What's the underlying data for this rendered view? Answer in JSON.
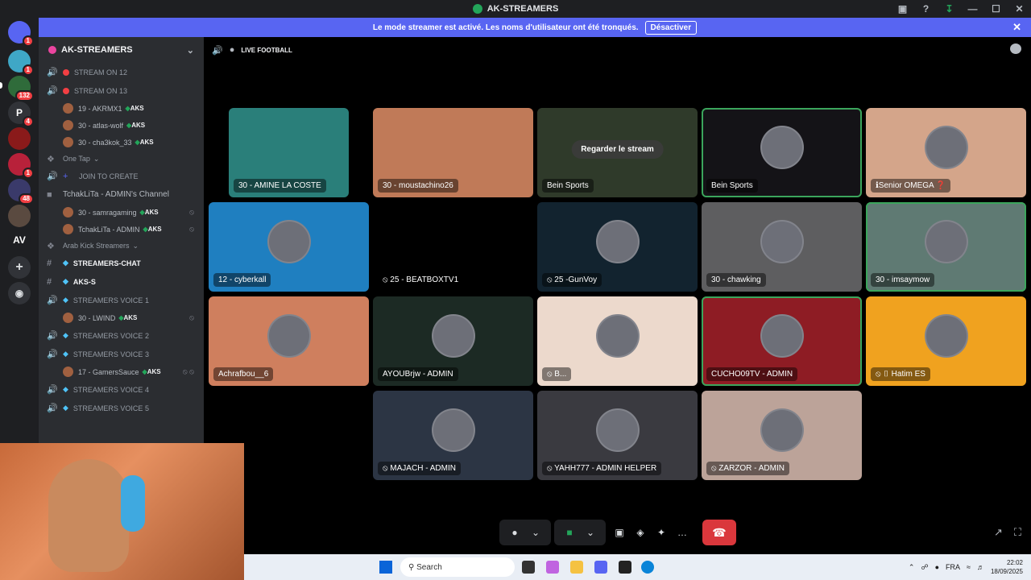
{
  "window": {
    "title": "AK-STREAMERS",
    "controls": [
      "—",
      "☐",
      "✕"
    ]
  },
  "banner": {
    "message": "Le mode streamer est activé. Les noms d'utilisateur ont été tronqués.",
    "button": "Désactiver"
  },
  "servers": [
    {
      "label": "",
      "badge": "1"
    },
    {
      "label": "",
      "badge": "1"
    },
    {
      "label": "",
      "badge": "132"
    },
    {
      "label": "P",
      "badge": "4"
    },
    {
      "label": "",
      "badge": ""
    },
    {
      "label": "",
      "badge": "1"
    },
    {
      "label": "",
      "badge": "48"
    },
    {
      "label": "",
      "badge": ""
    },
    {
      "label": "AV",
      "badge": ""
    }
  ],
  "sidebar": {
    "guild_name": "AK-STREAMERS",
    "items": [
      {
        "kind": "channel",
        "name": "STREAM ON 12",
        "icon": "dot"
      },
      {
        "kind": "channel",
        "name": "STREAM ON 13",
        "icon": "dot"
      },
      {
        "kind": "user",
        "name": "19 - AKRMX1",
        "tag": "AKS",
        "mute": ""
      },
      {
        "kind": "user",
        "name": "30 - atlas-wolf",
        "tag": "AKS",
        "mute": ""
      },
      {
        "kind": "user",
        "name": "30 - cha3kok_33",
        "tag": "AKS",
        "mute": ""
      },
      {
        "kind": "category",
        "name": "One Tap"
      },
      {
        "kind": "channel",
        "name": "JOIN TO CREATE",
        "icon": "plus"
      },
      {
        "kind": "locked",
        "name": "TchakLiTa - ADMIN's Channel"
      },
      {
        "kind": "user",
        "name": "30 - samragaming",
        "tag": "AKS",
        "mute": "⦸"
      },
      {
        "kind": "user",
        "name": "TchakLiTa - ADMIN",
        "tag": "AKS",
        "mute": "⦸"
      },
      {
        "kind": "category",
        "name": "Arab Kick Streamers"
      },
      {
        "kind": "text",
        "name": "STREAMERS-CHAT",
        "active": true
      },
      {
        "kind": "text",
        "name": "AKS-S",
        "active": true
      },
      {
        "kind": "channel",
        "name": "STREAMERS VOICE 1",
        "icon": "gem"
      },
      {
        "kind": "user",
        "name": "30 - LWIND",
        "tag": "AKS",
        "mute": "⦸"
      },
      {
        "kind": "channel",
        "name": "STREAMERS VOICE 2",
        "icon": "gem"
      },
      {
        "kind": "channel",
        "name": "STREAMERS VOICE 3",
        "icon": "gem"
      },
      {
        "kind": "user",
        "name": "17 - GamersSauce",
        "tag": "AKS",
        "mute": "⦸ ⦸"
      },
      {
        "kind": "channel",
        "name": "STREAMERS VOICE 4",
        "icon": "gem"
      },
      {
        "kind": "channel",
        "name": "STREAMERS VOICE 5",
        "icon": "gem"
      }
    ]
  },
  "stage": {
    "channel_name": "LIVE FOOTBALL",
    "watch_stream_label": "Regarder le stream",
    "tiles": [
      {
        "label": "30 - AMINE LA COSTE",
        "color": "#2a7f7a",
        "avatar": false,
        "speaking": false
      },
      {
        "label": "30 - moustachino26",
        "color": "#c07a58",
        "avatar": false,
        "speaking": false
      },
      {
        "label": "Bein Sports",
        "color": "#2f3a2a",
        "avatar": false,
        "speaking": false,
        "stream": true
      },
      {
        "label": "Bein Sports",
        "color": "#141317",
        "avatar": true,
        "speaking": true
      },
      {
        "label": "ℹSenior OMEGA ❓",
        "color": "#d4a58a",
        "avatar": true,
        "speaking": false
      },
      {
        "label": "12 - cyberkall",
        "color": "#1f7fc0",
        "avatar": true,
        "speaking": false
      },
      {
        "label": "⦸ 25 - BEATBOXTV1",
        "color": "#000000",
        "avatar": false,
        "speaking": false
      },
      {
        "label": "⦸ 25 -GunVoy",
        "color": "#12232f",
        "avatar": true,
        "speaking": false
      },
      {
        "label": "30 - chawking",
        "color": "#5e5e60",
        "avatar": true,
        "speaking": false
      },
      {
        "label": "30 - imsaymow",
        "color": "#5f7a73",
        "avatar": true,
        "speaking": true
      },
      {
        "label": "Achrafbou__6",
        "color": "#cf7f5e",
        "avatar": true,
        "speaking": false
      },
      {
        "label": "AYOUBrjw - ADMIN",
        "color": "#1c2a24",
        "avatar": true,
        "speaking": false
      },
      {
        "label": "⦸ B...",
        "color": "#ecd9cc",
        "avatar": true,
        "speaking": false
      },
      {
        "label": "CUCHO09TV - ADMIN",
        "color": "#8e1c24",
        "avatar": true,
        "speaking": true
      },
      {
        "label": "⦸ ▯ Hatim ES",
        "color": "#f0a21f",
        "avatar": true,
        "speaking": false
      },
      {
        "label": "⦸ MAJACH - ADMIN",
        "color": "#2c3544",
        "avatar": true,
        "speaking": false
      },
      {
        "label": "⦸ YAHH777 - ADMIN HELPER",
        "color": "#3a3a40",
        "avatar": true,
        "speaking": false
      },
      {
        "label": "⦸ ZARZOR - ADMIN",
        "color": "#bca399",
        "avatar": true,
        "speaking": false
      }
    ]
  },
  "controls": {
    "mic": "●",
    "camera": "■",
    "share": "▣",
    "activity": "◈",
    "effects": "✦",
    "more": "…",
    "hangup": "☎"
  },
  "taskbar": {
    "search_placeholder": "Search",
    "lang": "FRA",
    "time": "22:02",
    "date": "18/09/2025"
  }
}
